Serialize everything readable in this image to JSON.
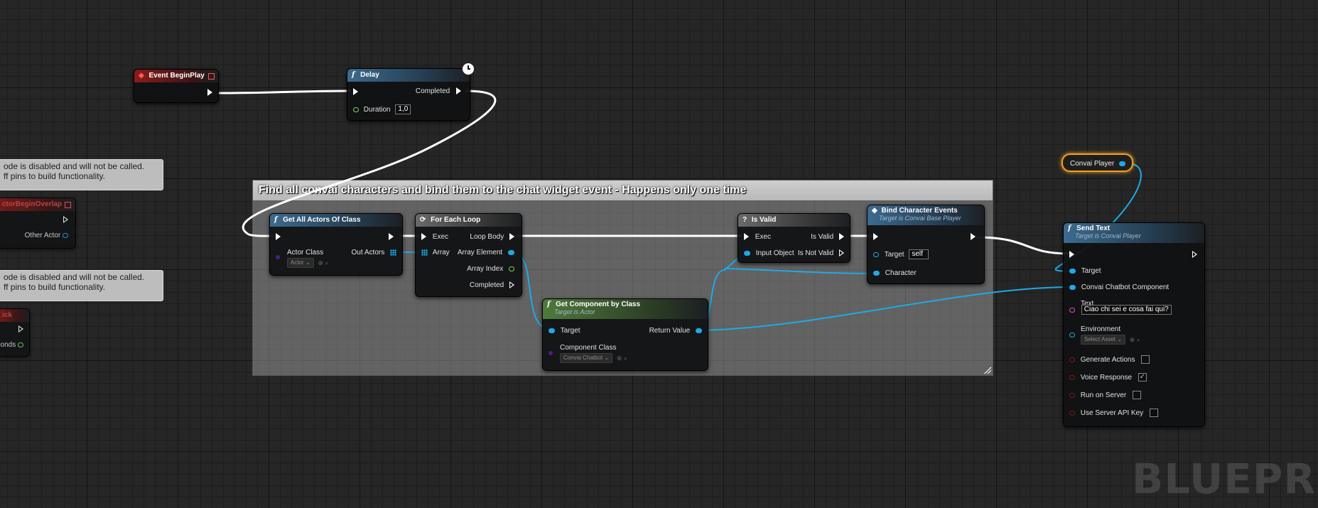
{
  "comment": {
    "title": "Find all convai characters and bind them to the chat widget event - Happens only one time"
  },
  "disabled_notes": [
    {
      "line1": "ode is disabled and will not be called.",
      "line2": "ff pins to build functionality."
    },
    {
      "line1": "ode is disabled and will not be called.",
      "line2": "ff pins to build functionality."
    }
  ],
  "partial_nodes": {
    "overlap_title": "ctorBeginOverlap",
    "overlap_pin": "Other Actor",
    "tick_title": "ick",
    "tick_pin": "onds"
  },
  "nodes": {
    "event_begin_play": {
      "title": "Event BeginPlay"
    },
    "delay": {
      "title": "Delay",
      "completed": "Completed",
      "duration_label": "Duration",
      "duration_value": "1,0"
    },
    "get_all_actors": {
      "title": "Get All Actors Of Class",
      "actor_class": "Actor Class",
      "actor_value": "Actor",
      "out_actors": "Out Actors"
    },
    "for_each": {
      "title": "For Each Loop",
      "exec": "Exec",
      "loop_body": "Loop Body",
      "array": "Array",
      "array_element": "Array Element",
      "array_index": "Array Index",
      "completed": "Completed"
    },
    "get_component": {
      "title": "Get Component by Class",
      "subtitle": "Target is Actor",
      "target": "Target",
      "return_value": "Return Value",
      "component_class": "Component Class",
      "component_value": "Convai Chatbot"
    },
    "is_valid": {
      "title": "Is Valid",
      "exec": "Exec",
      "is_valid": "Is Valid",
      "input_object": "Input Object",
      "is_not_valid": "Is Not Valid"
    },
    "bind_events": {
      "title": "Bind Character Events",
      "subtitle": "Target is Convai Base Player",
      "target": "Target",
      "target_value": "self",
      "character": "Character"
    },
    "convai_player": {
      "title": "Convai Player"
    },
    "send_text": {
      "title": "Send Text",
      "subtitle": "Target is Convai Player",
      "target": "Target",
      "chatbot": "Convai Chatbot Component",
      "text_label": "Text",
      "text_value": "Ciao chi sei e cosa fai qui?",
      "environment": "Environment",
      "environment_value": "Select Asset",
      "generate_actions": "Generate Actions",
      "generate_actions_checked": false,
      "voice_response": "Voice Response",
      "voice_response_checked": true,
      "run_on_server": "Run on Server",
      "run_on_server_checked": false,
      "use_server_api_key": "Use Server API Key",
      "use_server_api_key_checked": false
    }
  },
  "watermark": "BLUEPRIN",
  "colors": {
    "exec_wire": "#ffffff",
    "object_wire": "#1fa9e8",
    "function_header": "#3c6a8e",
    "event_header": "#8b1b1b",
    "pure_header": "#4f7a3c",
    "variable_outline": "#f0a020"
  }
}
